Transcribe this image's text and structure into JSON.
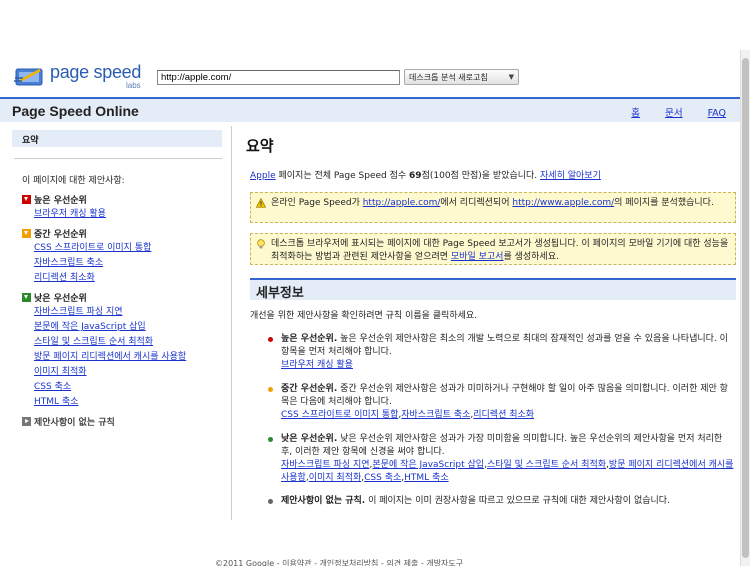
{
  "header": {
    "logo_text": "page speed",
    "logo_sub": "labs",
    "url_value": "http://apple.com/",
    "analyze_label": "데스크톱 분석 새로고침"
  },
  "navbar": {
    "title": "Page Speed Online",
    "links": [
      "홈",
      "문서",
      "FAQ"
    ]
  },
  "sidebar": {
    "summary_tab": "요약",
    "heading": "이 페이지에 대한 제안사항:",
    "groups": [
      {
        "title": "높은 우선순위",
        "color": "#cc0000",
        "items": [
          "브라우저 캐싱 활용"
        ]
      },
      {
        "title": "중간 우선순위",
        "color": "#f0a000",
        "items": [
          "CSS 스프라이트로 이미지 통합",
          "자바스크립트 축소",
          "리디렉션 최소화"
        ]
      },
      {
        "title": "낮은 우선순위",
        "color": "#2a8a2a",
        "items": [
          "자바스크립트 파싱 지연",
          "본문에 작은 JavaScript 삽입",
          "스타일 및 스크립트 순서 최적화",
          "방문 페이지 리디렉션에서 캐시를 사용함",
          "이미지 최적화",
          "CSS 축소",
          "HTML 축소"
        ]
      }
    ],
    "no_suggestion": "제안사항이 없는 규칙"
  },
  "main": {
    "title": "요약",
    "score": {
      "site_link": "Apple",
      "text_before": " 페이지는 전체 Page Speed 점수 ",
      "score_value": "69",
      "text_after": "점(100점 만점)을 받았습니다. ",
      "more_link": "자세히 알아보기"
    },
    "notice1": {
      "p1": "온라인 Page Speed가 ",
      "link1": "http://apple.com/",
      "p2": "에서 리디렉션되어 ",
      "link2": "http://www.apple.com/",
      "p3": "의 페이지를 분석했습니다."
    },
    "notice2": {
      "p1": "데스크톱 브라우저에 표시되는 페이지에 대한 Page Speed 보고서가 생성됩니다. 이 페이지의 모바일 기기에 대한 성능을 최적화하는 방법과 관련된 제안사항을 얻으려면 ",
      "link": "모바일 보고서",
      "p2": "를 생성하세요."
    },
    "details_title": "세부정보",
    "details_intro": "개선을 위한 제안사항을 확인하려면 규칙 이름을 클릭하세요.",
    "high": {
      "label": "높은 우선순위.",
      "text": " 높은 우선순위 제안사항은 최소의 개발 노력으로 최대의 잠재적인 성과를 얻을 수 있음을 나타냅니다. 이 항목을 먼저 처리해야 합니다.",
      "links": [
        "브라우저 캐싱 활용"
      ]
    },
    "medium": {
      "label": "중간 우선순위.",
      "text": " 중간 우선순위 제안사항은 성과가 미미하거나 구현해야 할 일이 아주 많음을 의미합니다. 이러한 제안 항목은 다음에 처리해야 합니다.",
      "links": [
        "CSS 스프라이트로 이미지 통합",
        "자바스크립트 축소",
        "리디렉션 최소화"
      ]
    },
    "low": {
      "label": "낮은 우선순위.",
      "text": " 낮은 우선순위 제안사항은 성과가 가장 미미함을 의미합니다. 높은 우선순위의 제안사항을 먼저 처리한 후, 이러한 제안 항목에 신경을 써야 합니다.",
      "links": [
        "자바스크립트 파싱 지연",
        "본문에 작은 JavaScript 삽입",
        "스타일 및 스크립트 순서 최적화",
        "방문 페이지 리디렉션에서 캐시를 사용함",
        "이미지 최적화",
        "CSS 축소",
        "HTML 축소"
      ]
    },
    "none": {
      "label": "제안사항이 없는 규칙.",
      "text": " 이 페이지는 이미 권장사항을 따르고 있으므로 규칙에 대한 제안사항이 없습니다."
    }
  },
  "footer": "©2011 Google - 이용약관 - 개인정보처리방침 - 의견 제출 - 개발자도구",
  "colors": {
    "accent": "#3366cc",
    "link": "#1a33cc",
    "bar": "#e4ecf7",
    "notice_bg": "#fff9cf"
  }
}
